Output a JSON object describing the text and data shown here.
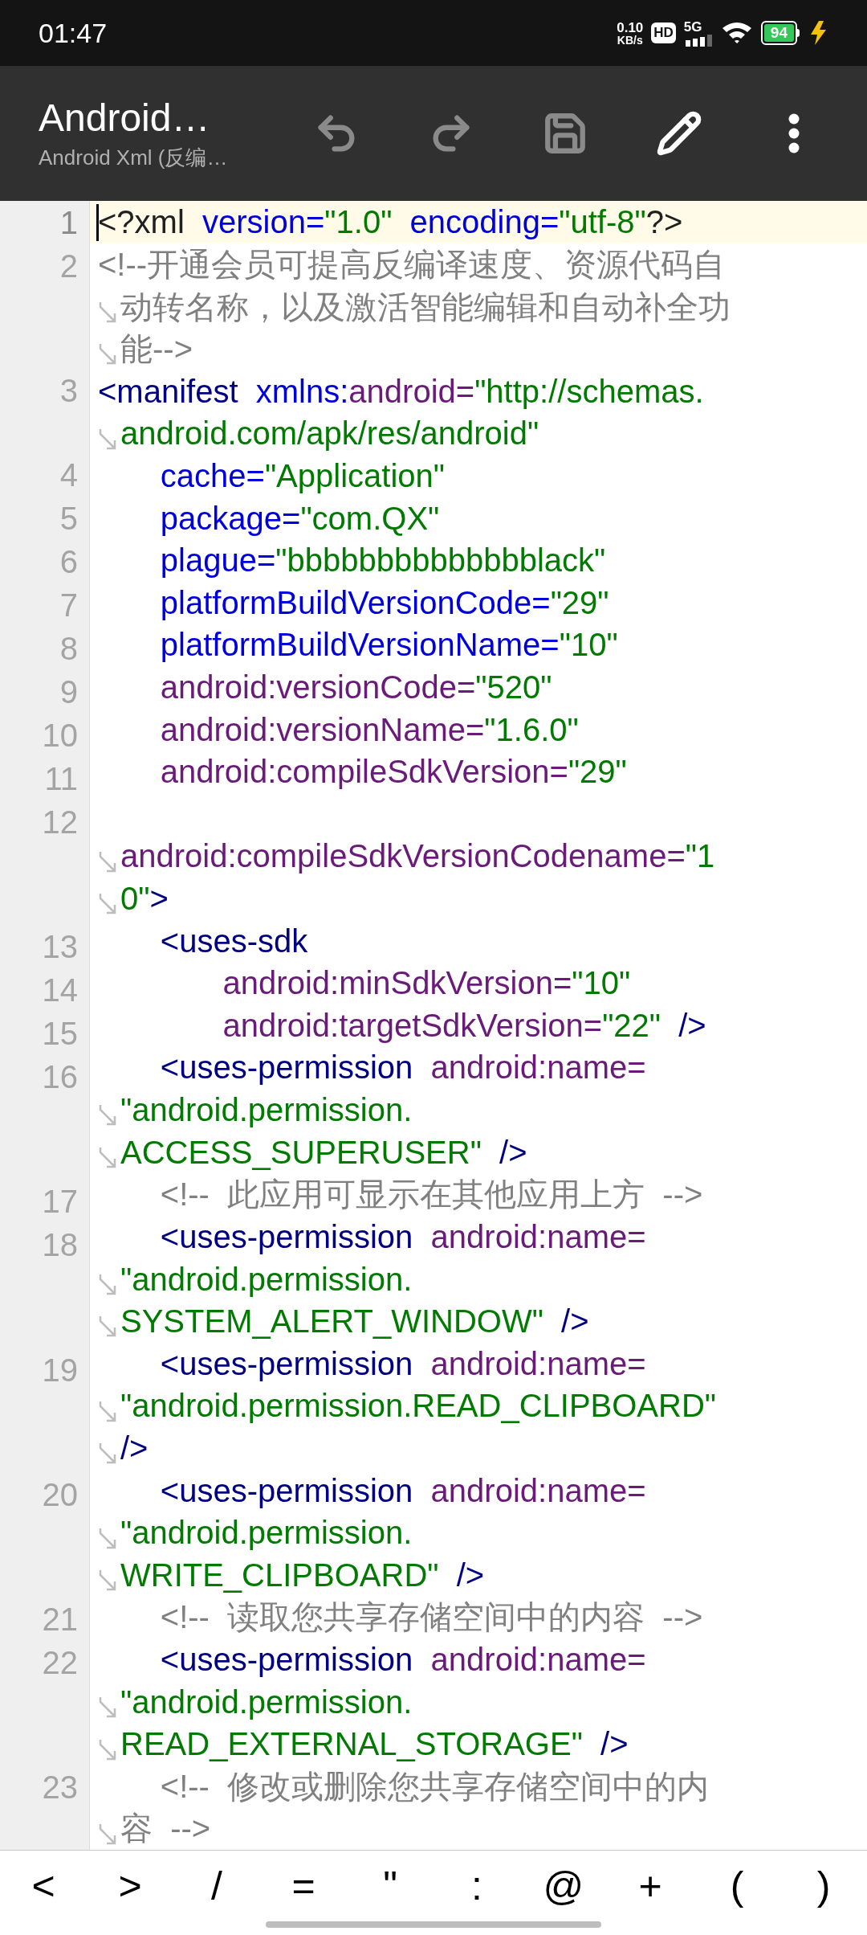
{
  "status_bar": {
    "time": "01:47",
    "net_speed": "0.10",
    "net_unit": "KB/s",
    "hd": "HD",
    "network": "5G",
    "battery": "94"
  },
  "toolbar": {
    "title": "Android…",
    "subtitle": "Android Xml (反编…",
    "actions": [
      {
        "kind": "undo",
        "disabled": true
      },
      {
        "kind": "redo",
        "disabled": true
      },
      {
        "kind": "save",
        "disabled": true
      },
      {
        "kind": "edit",
        "disabled": false
      },
      {
        "kind": "more",
        "disabled": false
      }
    ]
  },
  "editor": {
    "lines": [
      {
        "number": "1",
        "current": true,
        "rows": [
          {
            "tokens": [
              {
                "kind": "punct",
                "text": "<?xml"
              },
              {
                "kind": "attr",
                "text": "  version="
              },
              {
                "kind": "value",
                "text": "\"1.0\""
              },
              {
                "kind": "attr",
                "text": "  encoding="
              },
              {
                "kind": "value",
                "text": "\"utf-8\""
              },
              {
                "kind": "punct",
                "text": "?>"
              }
            ]
          }
        ]
      },
      {
        "number": "2",
        "current": false,
        "rows": [
          {
            "tokens": [
              {
                "kind": "comment",
                "text": "<!--开通会员可提高反编译速度、资源代码自"
              }
            ]
          },
          {
            "tokens": [
              {
                "kind": "comment",
                "text": "动转名称，以及激活智能编辑和自动补全功"
              }
            ]
          },
          {
            "tokens": [
              {
                "kind": "comment",
                "text": "能-->"
              }
            ]
          }
        ]
      },
      {
        "number": "3",
        "current": false,
        "rows": [
          {
            "tokens": [
              {
                "kind": "tag",
                "text": "<manifest"
              },
              {
                "kind": "attr",
                "text": "  xmlns:"
              },
              {
                "kind": "ns",
                "text": "android="
              },
              {
                "kind": "value",
                "text": "\"http://schemas."
              }
            ]
          },
          {
            "tokens": [
              {
                "kind": "value",
                "text": "android.com/apk/res/android\""
              }
            ]
          }
        ]
      },
      {
        "number": "4",
        "current": false,
        "rows": [
          {
            "tokens": [
              {
                "kind": "attr",
                "text": "       cache="
              },
              {
                "kind": "value",
                "text": "\"Application\""
              }
            ]
          }
        ]
      },
      {
        "number": "5",
        "current": false,
        "rows": [
          {
            "tokens": [
              {
                "kind": "attr",
                "text": "       package="
              },
              {
                "kind": "value",
                "text": "\"com.QX\""
              }
            ]
          }
        ]
      },
      {
        "number": "6",
        "current": false,
        "rows": [
          {
            "tokens": [
              {
                "kind": "attr",
                "text": "       plague="
              },
              {
                "kind": "value",
                "text": "\"bbbbbbbbbbbbbblack\""
              }
            ]
          }
        ]
      },
      {
        "number": "7",
        "current": false,
        "rows": [
          {
            "tokens": [
              {
                "kind": "attr",
                "text": "       platformBuildVersionCode="
              },
              {
                "kind": "value",
                "text": "\"29\""
              }
            ]
          }
        ]
      },
      {
        "number": "8",
        "current": false,
        "rows": [
          {
            "tokens": [
              {
                "kind": "attr",
                "text": "       platformBuildVersionName="
              },
              {
                "kind": "value",
                "text": "\"10\""
              }
            ]
          }
        ]
      },
      {
        "number": "9",
        "current": false,
        "rows": [
          {
            "tokens": [
              {
                "kind": "ns",
                "text": "       android:versionCode="
              },
              {
                "kind": "value",
                "text": "\"520\""
              }
            ]
          }
        ]
      },
      {
        "number": "10",
        "current": false,
        "rows": [
          {
            "tokens": [
              {
                "kind": "ns",
                "text": "       android:versionName="
              },
              {
                "kind": "value",
                "text": "\"1.6.0\""
              }
            ]
          }
        ]
      },
      {
        "number": "11",
        "current": false,
        "rows": [
          {
            "tokens": [
              {
                "kind": "ns",
                "text": "       android:compileSdkVersion="
              },
              {
                "kind": "value",
                "text": "\"29\""
              }
            ]
          }
        ]
      },
      {
        "number": "12",
        "current": false,
        "break_before": true,
        "rows": [
          {
            "tokens": [
              {
                "kind": "ns",
                "text": "android:compileSdkVersionCodename="
              },
              {
                "kind": "value",
                "text": "\"1"
              }
            ]
          },
          {
            "tokens": [
              {
                "kind": "value",
                "text": "0\""
              },
              {
                "kind": "tag",
                "text": ">"
              }
            ]
          }
        ]
      },
      {
        "number": "13",
        "current": false,
        "rows": [
          {
            "tokens": [
              {
                "kind": "tag",
                "text": "       <uses-sdk"
              }
            ]
          }
        ]
      },
      {
        "number": "14",
        "current": false,
        "rows": [
          {
            "tokens": [
              {
                "kind": "ns",
                "text": "              android:minSdkVersion="
              },
              {
                "kind": "value",
                "text": "\"10\""
              }
            ]
          }
        ]
      },
      {
        "number": "15",
        "current": false,
        "rows": [
          {
            "tokens": [
              {
                "kind": "ns",
                "text": "              android:targetSdkVersion="
              },
              {
                "kind": "value",
                "text": "\"22\""
              },
              {
                "kind": "tag",
                "text": "  />"
              }
            ]
          }
        ]
      },
      {
        "number": "16",
        "current": false,
        "rows": [
          {
            "tokens": [
              {
                "kind": "tag",
                "text": "       <uses-permission"
              },
              {
                "kind": "ns",
                "text": "  android:name="
              }
            ]
          },
          {
            "tokens": [
              {
                "kind": "value",
                "text": "\"android.permission."
              }
            ]
          },
          {
            "tokens": [
              {
                "kind": "value",
                "text": "ACCESS_SUPERUSER\""
              },
              {
                "kind": "tag",
                "text": "  />"
              }
            ]
          }
        ]
      },
      {
        "number": "17",
        "current": false,
        "rows": [
          {
            "tokens": [
              {
                "kind": "comment",
                "text": "       <!--  此应用可显示在其他应用上方  -->"
              }
            ]
          }
        ]
      },
      {
        "number": "18",
        "current": false,
        "rows": [
          {
            "tokens": [
              {
                "kind": "tag",
                "text": "       <uses-permission"
              },
              {
                "kind": "ns",
                "text": "  android:name="
              }
            ]
          },
          {
            "tokens": [
              {
                "kind": "value",
                "text": "\"android.permission."
              }
            ]
          },
          {
            "tokens": [
              {
                "kind": "value",
                "text": "SYSTEM_ALERT_WINDOW\""
              },
              {
                "kind": "tag",
                "text": "  />"
              }
            ]
          }
        ]
      },
      {
        "number": "19",
        "current": false,
        "rows": [
          {
            "tokens": [
              {
                "kind": "tag",
                "text": "       <uses-permission"
              },
              {
                "kind": "ns",
                "text": "  android:name="
              }
            ]
          },
          {
            "tokens": [
              {
                "kind": "value",
                "text": "\"android.permission.READ_CLIPBOARD\""
              }
            ]
          },
          {
            "tokens": [
              {
                "kind": "tag",
                "text": "/>"
              }
            ]
          }
        ]
      },
      {
        "number": "20",
        "current": false,
        "rows": [
          {
            "tokens": [
              {
                "kind": "tag",
                "text": "       <uses-permission"
              },
              {
                "kind": "ns",
                "text": "  android:name="
              }
            ]
          },
          {
            "tokens": [
              {
                "kind": "value",
                "text": "\"android.permission."
              }
            ]
          },
          {
            "tokens": [
              {
                "kind": "value",
                "text": "WRITE_CLIPBOARD\""
              },
              {
                "kind": "tag",
                "text": "  />"
              }
            ]
          }
        ]
      },
      {
        "number": "21",
        "current": false,
        "rows": [
          {
            "tokens": [
              {
                "kind": "comment",
                "text": "       <!--  读取您共享存储空间中的内容  -->"
              }
            ]
          }
        ]
      },
      {
        "number": "22",
        "current": false,
        "rows": [
          {
            "tokens": [
              {
                "kind": "tag",
                "text": "       <uses-permission"
              },
              {
                "kind": "ns",
                "text": "  android:name="
              }
            ]
          },
          {
            "tokens": [
              {
                "kind": "value",
                "text": "\"android.permission."
              }
            ]
          },
          {
            "tokens": [
              {
                "kind": "value",
                "text": "READ_EXTERNAL_STORAGE\""
              },
              {
                "kind": "tag",
                "text": "  />"
              }
            ]
          }
        ]
      },
      {
        "number": "23",
        "current": false,
        "rows": [
          {
            "tokens": [
              {
                "kind": "comment",
                "text": "       <!--  修改或删除您共享存储空间中的内"
              }
            ]
          },
          {
            "tokens": [
              {
                "kind": "comment",
                "text": "容  -->"
              }
            ]
          }
        ]
      }
    ]
  },
  "symbol_keys": [
    "<",
    ">",
    "/",
    "=",
    "\"",
    ":",
    "@",
    "+",
    "(",
    ")"
  ]
}
